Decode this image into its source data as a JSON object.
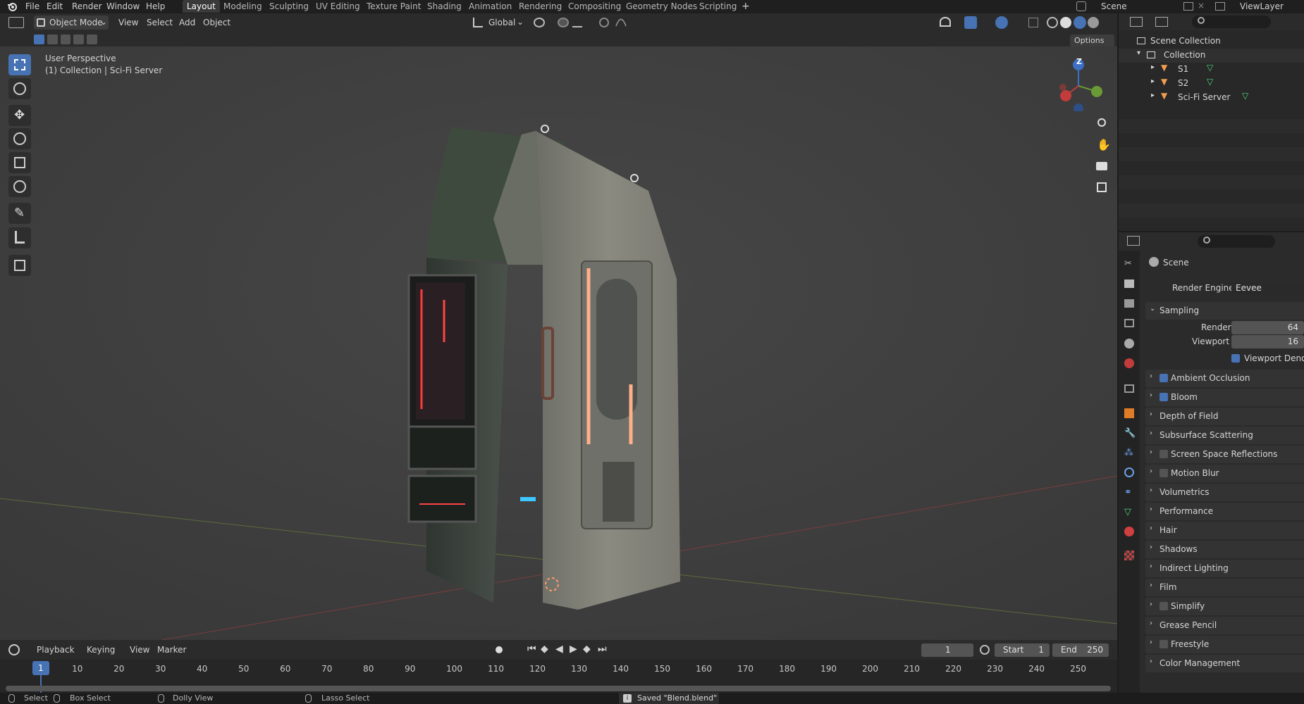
{
  "app_menu": [
    "File",
    "Edit",
    "Render",
    "Window",
    "Help"
  ],
  "workspace_tabs": [
    "Layout",
    "Modeling",
    "Sculpting",
    "UV Editing",
    "Texture Paint",
    "Shading",
    "Animation",
    "Rendering",
    "Compositing",
    "Geometry Nodes",
    "Scripting"
  ],
  "active_workspace": "Layout",
  "scene": {
    "label": "Scene",
    "view_layer": "ViewLayer"
  },
  "viewport_header": {
    "mode": "Object Mode",
    "view": "View",
    "select": "Select",
    "add": "Add",
    "object": "Object",
    "transform_orientation": "Global",
    "options": "Options"
  },
  "viewport_overlay": {
    "line1": "User Perspective",
    "line2": "(1) Collection | Sci-Fi Server"
  },
  "gizmo": {
    "z": "Z"
  },
  "outliner": {
    "root": "Scene Collection",
    "collection": "Collection",
    "items": [
      "S1",
      "S2",
      "Sci-Fi Server"
    ]
  },
  "properties": {
    "context": "Scene",
    "render_engine_label": "Render Engine",
    "render_engine": "Eevee",
    "sampling": "Sampling",
    "render_label": "Render",
    "render_value": "64",
    "viewport_label": "Viewport",
    "viewport_value": "16",
    "viewport_denoise": "Viewport Denoising",
    "panels": [
      {
        "label": "Ambient Occlusion",
        "checkbox": true,
        "checked": true
      },
      {
        "label": "Bloom",
        "checkbox": true,
        "checked": true
      },
      {
        "label": "Depth of Field",
        "checkbox": false
      },
      {
        "label": "Subsurface Scattering",
        "checkbox": false
      },
      {
        "label": "Screen Space Reflections",
        "checkbox": true,
        "checked": false
      },
      {
        "label": "Motion Blur",
        "checkbox": true,
        "checked": false
      },
      {
        "label": "Volumetrics",
        "checkbox": false
      },
      {
        "label": "Performance",
        "checkbox": false
      },
      {
        "label": "Hair",
        "checkbox": false
      },
      {
        "label": "Shadows",
        "checkbox": false
      },
      {
        "label": "Indirect Lighting",
        "checkbox": false
      },
      {
        "label": "Film",
        "checkbox": false
      },
      {
        "label": "Simplify",
        "checkbox": true,
        "checked": false
      },
      {
        "label": "Grease Pencil",
        "checkbox": false
      },
      {
        "label": "Freestyle",
        "checkbox": true,
        "checked": false
      },
      {
        "label": "Color Management",
        "checkbox": false
      }
    ]
  },
  "timeline": {
    "playback": "Playback",
    "keying": "Keying",
    "view": "View",
    "marker": "Marker",
    "current_frame": "1",
    "start_label": "Start",
    "start": "1",
    "end_label": "End",
    "end": "250",
    "ticks": [
      "1",
      "10",
      "20",
      "30",
      "40",
      "50",
      "60",
      "70",
      "80",
      "90",
      "100",
      "110",
      "120",
      "130",
      "140",
      "150",
      "160",
      "170",
      "180",
      "190",
      "200",
      "210",
      "220",
      "230",
      "240",
      "250"
    ]
  },
  "statusbar": {
    "select": "Select",
    "box_select": "Box Select",
    "dolly_view": "Dolly View",
    "lasso_select": "Lasso Select",
    "message": "Saved \"Blend.blend\""
  }
}
